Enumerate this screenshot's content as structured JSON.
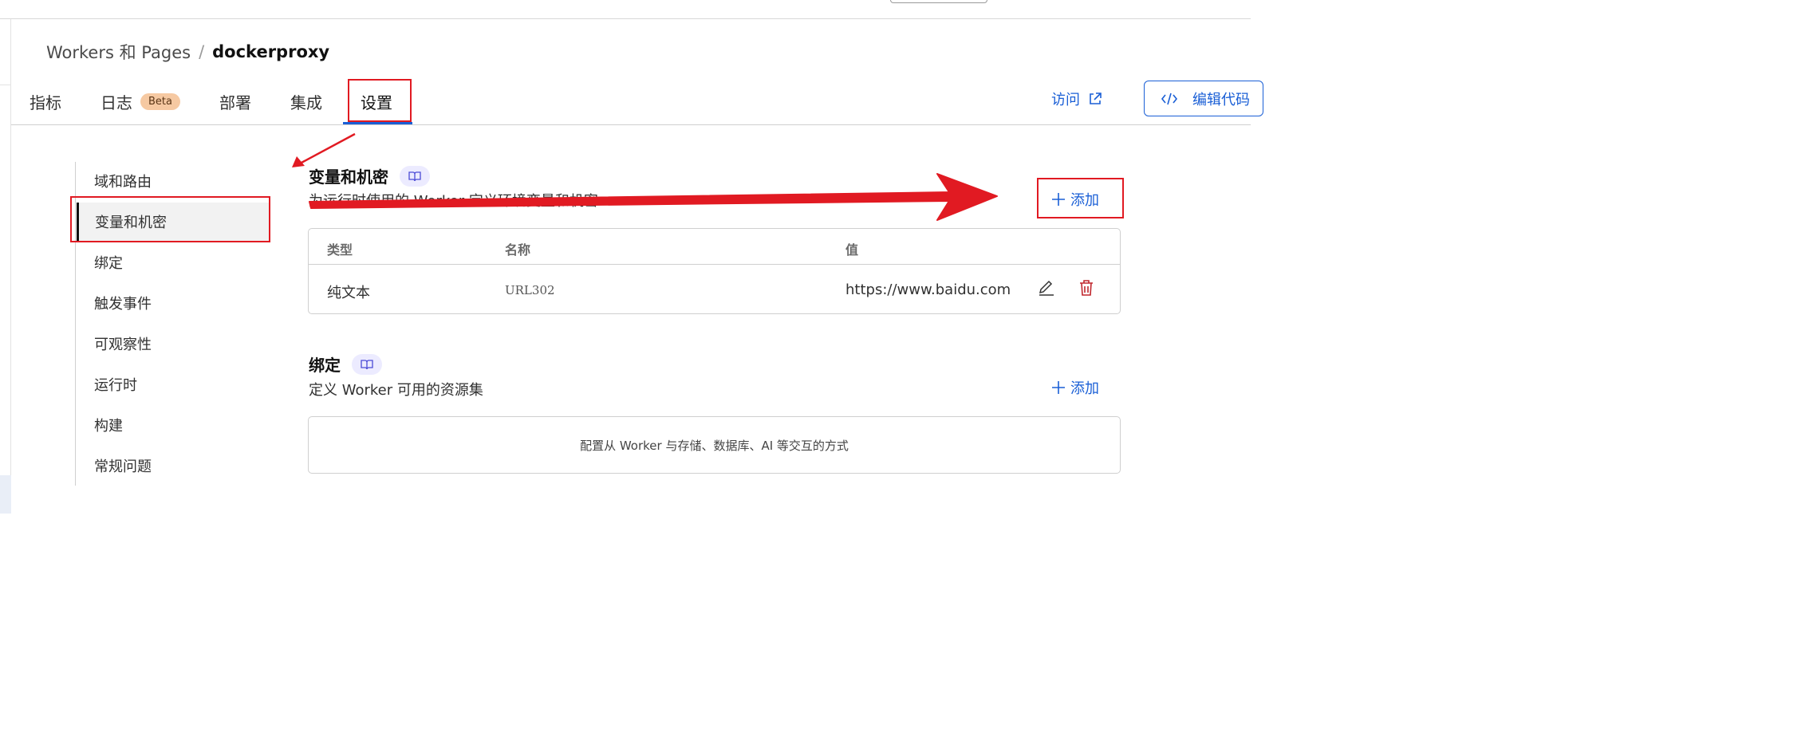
{
  "breadcrumb": {
    "root": "Workers 和 Pages",
    "separator": "/",
    "current": "dockerproxy"
  },
  "tabs": [
    {
      "label": "指标"
    },
    {
      "label": "日志",
      "badge": "Beta"
    },
    {
      "label": "部署"
    },
    {
      "label": "集成"
    },
    {
      "label": "设置",
      "active": true
    }
  ],
  "header_actions": {
    "visit": "访问",
    "edit_code": "编辑代码"
  },
  "sidebar": {
    "items": [
      {
        "label": "域和路由"
      },
      {
        "label": "变量和机密",
        "active": true
      },
      {
        "label": "绑定"
      },
      {
        "label": "触发事件"
      },
      {
        "label": "可观察性"
      },
      {
        "label": "运行时"
      },
      {
        "label": "构建"
      },
      {
        "label": "常规问题"
      }
    ]
  },
  "variables": {
    "title": "变量和机密",
    "description": "为运行时使用的 Worker 定义环境变量和机密",
    "add_label": "添加",
    "columns": [
      "类型",
      "名称",
      "值"
    ],
    "rows": [
      {
        "type": "纯文本",
        "name": "URL302",
        "value": "https://www.baidu.com"
      }
    ]
  },
  "bindings": {
    "title": "绑定",
    "description": "定义 Worker 可用的资源集",
    "add_label": "添加",
    "empty_text": "配置从 Worker 与存储、数据库、AI 等交互的方式"
  },
  "colors": {
    "accent": "#1a5fd6",
    "annotation": "#e11a22",
    "delete": "#c0262d",
    "badge_bg": "#f6c9a2"
  }
}
